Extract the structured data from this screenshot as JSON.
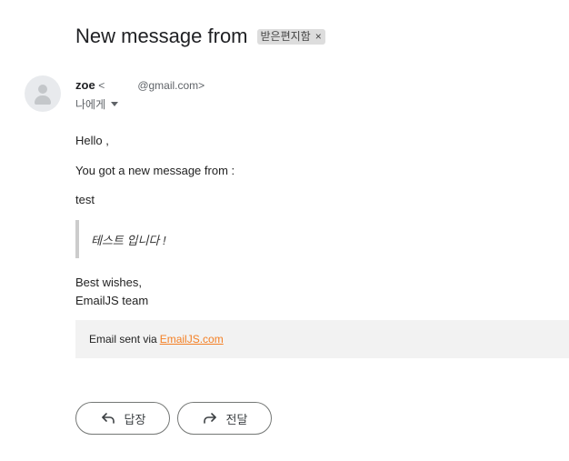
{
  "email": {
    "subject": "New message from",
    "label": "받은편지함",
    "label_remove": "×",
    "sender_name": "zoe",
    "sender_email_prefix": "<",
    "sender_email_suffix": "@gmail.com>",
    "recipient": "나에게"
  },
  "content": {
    "greeting": "Hello ,",
    "intro": "You got a new message from :",
    "sender_label": "test",
    "quote": "테스트 입니다 !",
    "signoff_line1": "Best wishes,",
    "signoff_line2": "EmailJS team"
  },
  "footer": {
    "prefix": "Email sent via",
    "link_text": "EmailJS.com",
    "link_color": "#f48025"
  },
  "actions": {
    "reply_label": "답장",
    "forward_label": "전달"
  },
  "icons": {
    "avatar": "person-icon",
    "reply": "reply-arrow-icon",
    "forward": "forward-arrow-icon"
  }
}
